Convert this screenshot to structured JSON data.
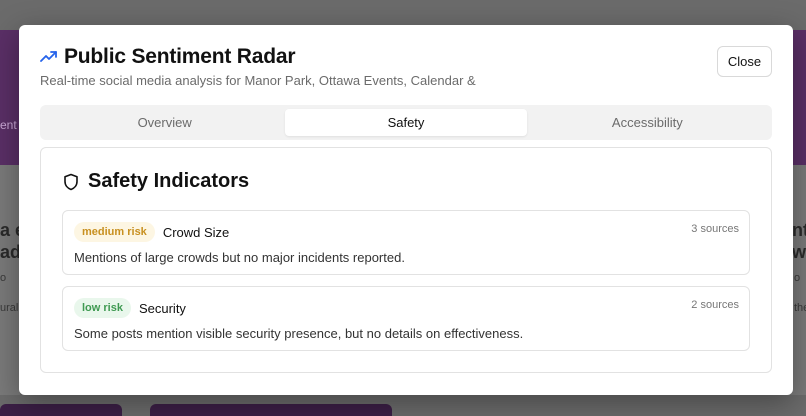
{
  "background": {
    "left_fragments": [
      "a e",
      "ad",
      "o",
      "ural",
      "ent"
    ],
    "right_fragments": [
      "nt",
      "w",
      "o",
      "the"
    ]
  },
  "modal": {
    "title": "Public Sentiment Radar",
    "title_icon": "trending-up-icon",
    "subtitle": "Real-time social media analysis for Manor Park, Ottawa Events, Calendar &",
    "close_label": "Close"
  },
  "tabs": [
    {
      "label": "Overview",
      "active": false
    },
    {
      "label": "Safety",
      "active": true
    },
    {
      "label": "Accessibility",
      "active": false
    }
  ],
  "panel": {
    "title": "Safety Indicators",
    "icon": "shield-icon",
    "indicators": [
      {
        "risk": "medium risk",
        "name": "Crowd Size",
        "sources": "3 sources",
        "description": "Mentions of large crowds but no major incidents reported."
      },
      {
        "risk": "low risk",
        "name": "Security",
        "sources": "2 sources",
        "description": "Some posts mention visible security presence, but no details on effectiveness."
      }
    ]
  },
  "colors": {
    "accent": "#2563eb",
    "medium_risk": "#c89020",
    "low_risk": "#3f9a52"
  }
}
